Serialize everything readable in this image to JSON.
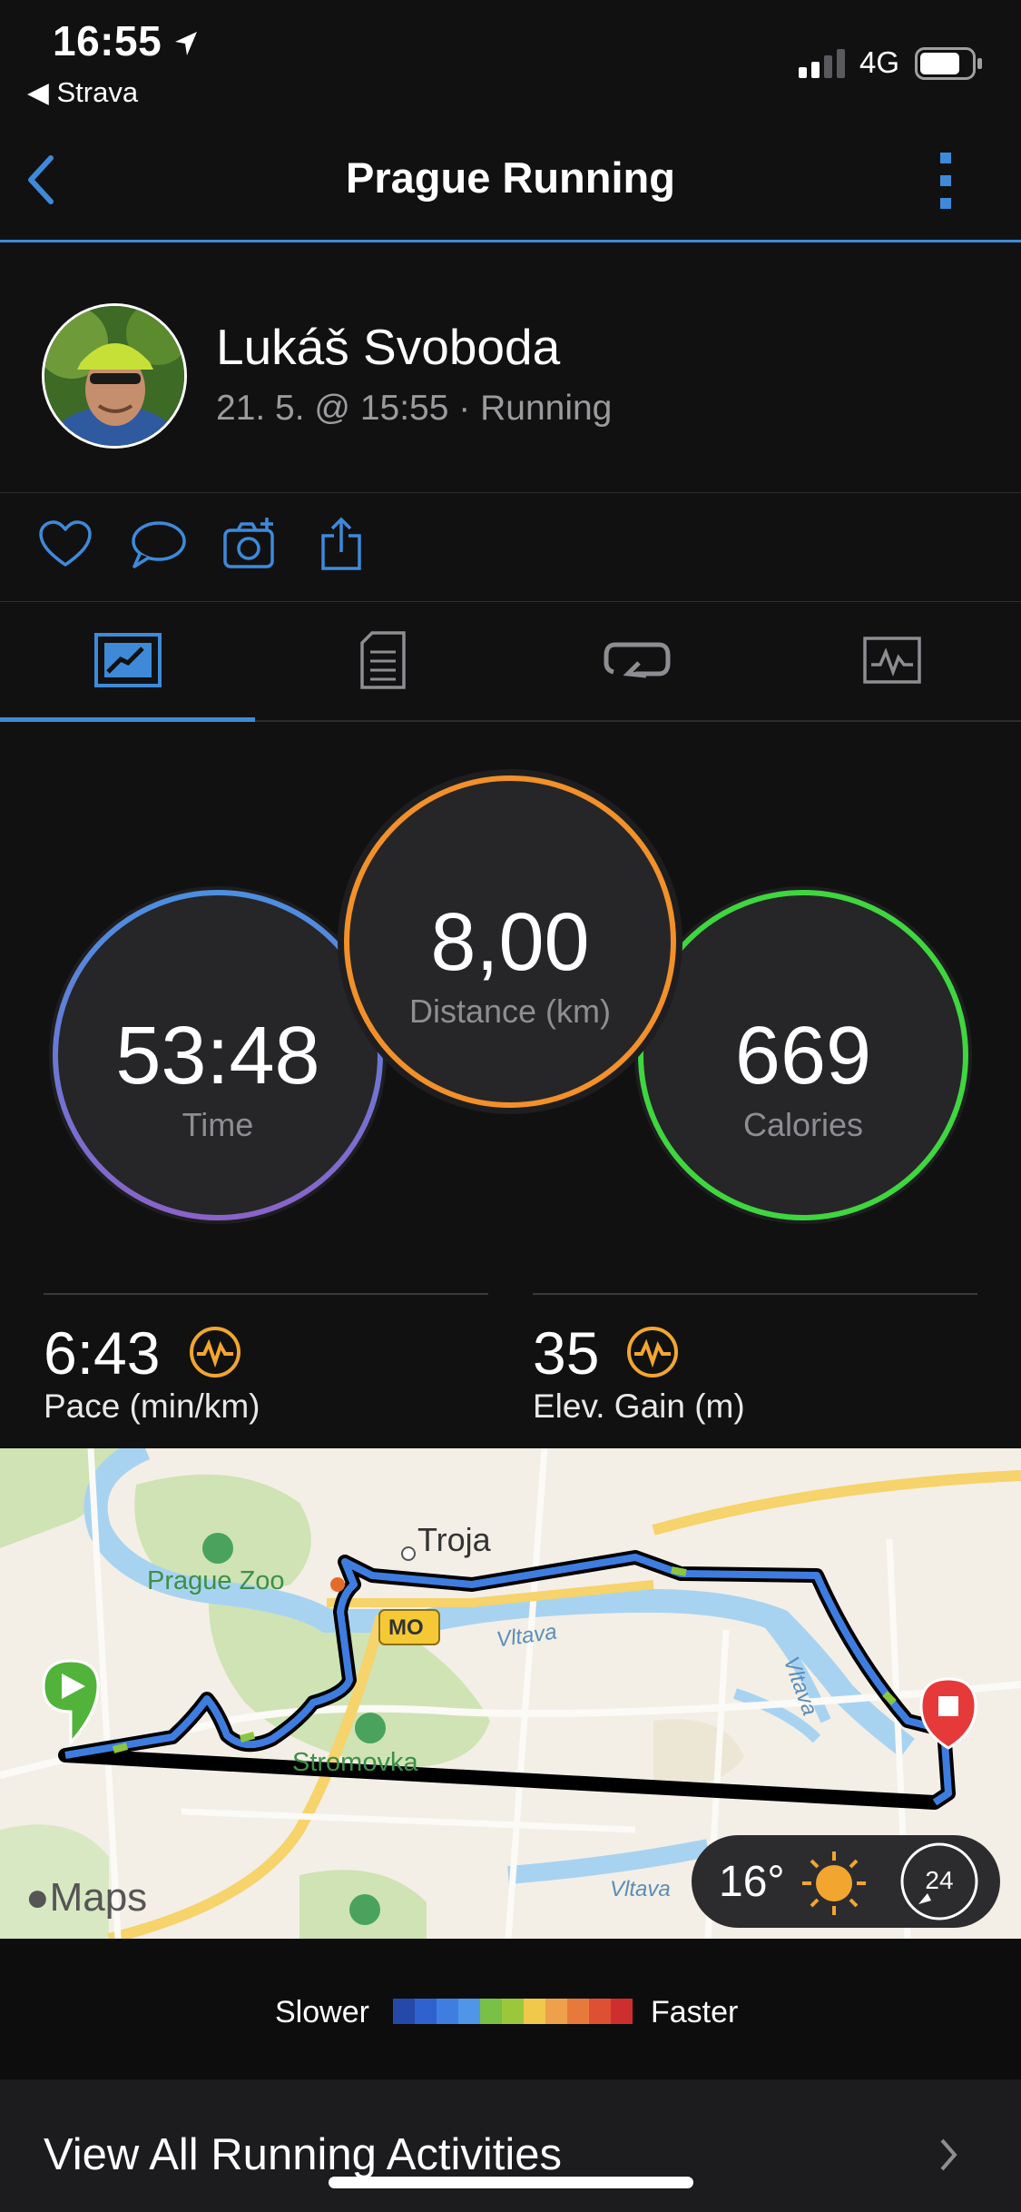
{
  "status_bar": {
    "time": "16:55",
    "back_app": "Strava",
    "network": "4G"
  },
  "header": {
    "title": "Prague Running"
  },
  "profile": {
    "name": "Lukáš Svoboda",
    "meta": "21. 5. @ 15:55 · Running"
  },
  "stats": {
    "time": {
      "value": "53:48",
      "label": "Time",
      "color": "#4b8fe0"
    },
    "distance": {
      "value": "8,00",
      "label": "Distance (km)",
      "color": "#f2902a"
    },
    "calories": {
      "value": "669",
      "label": "Calories",
      "color": "#3fd63f"
    }
  },
  "metrics": {
    "pace": {
      "value": "6:43",
      "label": "Pace (min/km)"
    },
    "elev": {
      "value": "35",
      "label": "Elev. Gain (m)"
    }
  },
  "map": {
    "labels": {
      "troja": "Troja",
      "zoo": "Prague Zoo",
      "stromovka": "Stromovka",
      "vltava": "Vltava",
      "mo": "MO",
      "maps": "Maps"
    },
    "weather": {
      "temp": "16°",
      "wind": "24"
    }
  },
  "legend": {
    "slower": "Slower",
    "faster": "Faster",
    "colors": [
      "#2449a8",
      "#2f62cf",
      "#3f7ee0",
      "#4f95e8",
      "#78c046",
      "#9bc83b",
      "#f0c84a",
      "#efa04a",
      "#e77a3a",
      "#dd5034",
      "#cf2e2e"
    ]
  },
  "footer": {
    "view_all": "View All Running Activities"
  },
  "colors": {
    "accent": "#3e8ad9",
    "orange_icon": "#f2a630"
  }
}
